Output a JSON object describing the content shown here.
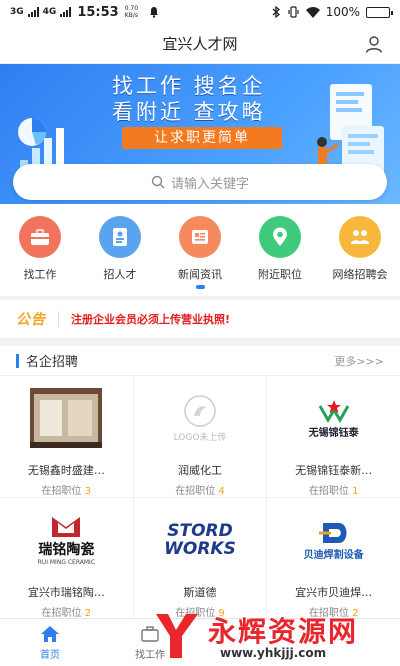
{
  "status": {
    "signal_a": "3G",
    "signal_b": "4G",
    "time": "15:53",
    "speed_value": "0.70",
    "speed_unit": "KB/s",
    "battery": "100%",
    "battery_level": 1.0
  },
  "header": {
    "title": "宜兴人才网"
  },
  "banner": {
    "line1": "找工作  搜名企",
    "line2": "看附近  查攻略",
    "slogan": "让求职更简单"
  },
  "search": {
    "placeholder": "请输入关键字"
  },
  "nav": [
    {
      "label": "找工作",
      "color": "#f2745f",
      "icon": "briefcase-icon"
    },
    {
      "label": "招人才",
      "color": "#5aa3ee",
      "icon": "resume-icon"
    },
    {
      "label": "新闻资讯",
      "color": "#f58a5c",
      "icon": "news-icon"
    },
    {
      "label": "附近职位",
      "color": "#3fca7c",
      "icon": "location-icon"
    },
    {
      "label": "网络招聘会",
      "color": "#f6b73c",
      "icon": "handshake-icon"
    }
  ],
  "notice": {
    "tag": "公告",
    "text": "注册企业会员必须上传营业执照!"
  },
  "section": {
    "title": "名企招聘",
    "more": "更多>>>"
  },
  "companies": [
    {
      "name": "无锡鑫时盛建…",
      "pos_label": "在招职位",
      "count": "3"
    },
    {
      "name": "润威化工",
      "pos_label": "在招职位",
      "count": "4",
      "logo_text": "LOGO未上传"
    },
    {
      "name": "无锡锦钰泰新…",
      "pos_label": "在招职位",
      "count": "1",
      "logo_text": "无锡锦钰泰"
    },
    {
      "name": "宜兴市瑞铭陶…",
      "pos_label": "在招职位",
      "count": "2",
      "logo_text": "瑞铭陶瓷",
      "logo_sub": "RUI MING CERAMIC"
    },
    {
      "name": "斯道德",
      "pos_label": "在招职位",
      "count": "9",
      "logo_text": "STORD",
      "logo_text2": "WORKS"
    },
    {
      "name": "宜兴市贝迪焊…",
      "pos_label": "在招职位",
      "count": "2",
      "logo_text": "贝迪焊割设备"
    }
  ],
  "tabs": [
    {
      "label": "首页"
    },
    {
      "label": "找工作"
    }
  ],
  "watermark": {
    "text": "永辉资源网",
    "url": "www.yhkjjj.com"
  },
  "colors": {
    "primary": "#2f7ef0",
    "notice_red": "#e02020",
    "accent_orange": "#f47a20"
  }
}
